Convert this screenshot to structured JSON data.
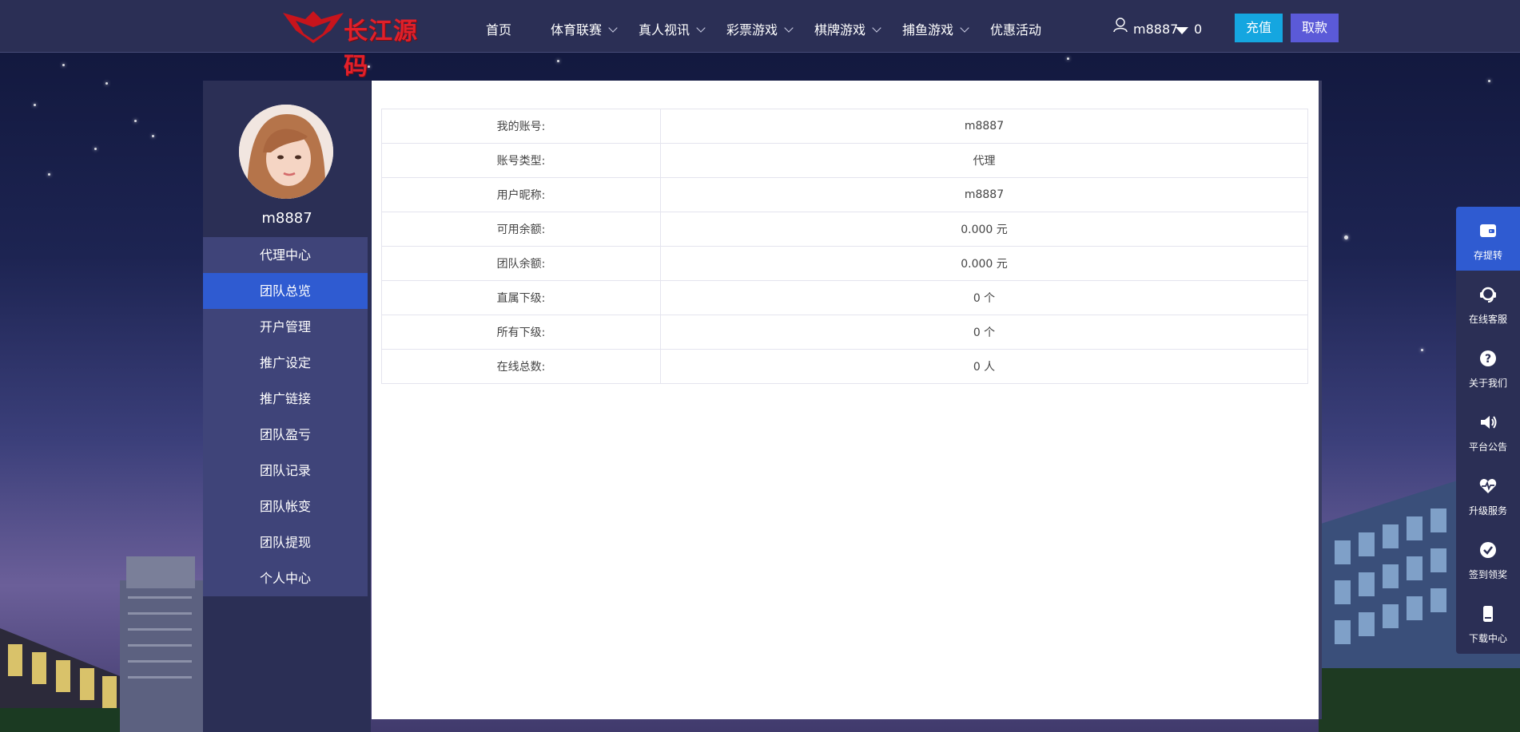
{
  "header": {
    "logo_text": "长江源码",
    "nav": [
      {
        "label": "首页",
        "dropdown": false
      },
      {
        "label": "体育联赛",
        "dropdown": true
      },
      {
        "label": "真人视讯",
        "dropdown": true
      },
      {
        "label": "彩票游戏",
        "dropdown": true
      },
      {
        "label": "棋牌游戏",
        "dropdown": true
      },
      {
        "label": "捕鱼游戏",
        "dropdown": true
      },
      {
        "label": "优惠活动",
        "dropdown": false
      }
    ],
    "user": {
      "name": "m8887",
      "balance": "0"
    },
    "deposit_label": "充值",
    "withdraw_label": "取款"
  },
  "sidebar": {
    "username": "m8887",
    "items": [
      {
        "label": "代理中心",
        "active": false
      },
      {
        "label": "团队总览",
        "active": true
      },
      {
        "label": "开户管理",
        "active": false
      },
      {
        "label": "推广设定",
        "active": false
      },
      {
        "label": "推广链接",
        "active": false
      },
      {
        "label": "团队盈亏",
        "active": false
      },
      {
        "label": "团队记录",
        "active": false
      },
      {
        "label": "团队帐变",
        "active": false
      },
      {
        "label": "团队提现",
        "active": false
      },
      {
        "label": "个人中心",
        "active": false
      }
    ]
  },
  "overview": {
    "rows": [
      {
        "label": "我的账号:",
        "value": "m8887"
      },
      {
        "label": "账号类型:",
        "value": "代理"
      },
      {
        "label": "用户昵称:",
        "value": "m8887"
      },
      {
        "label": "可用余额:",
        "value": "0.000 元"
      },
      {
        "label": "团队余额:",
        "value": "0.000 元"
      },
      {
        "label": "直属下级:",
        "value": "0 个"
      },
      {
        "label": "所有下级:",
        "value": "0 个"
      },
      {
        "label": "在线总数:",
        "value": "0 人"
      }
    ]
  },
  "float_bar": [
    {
      "label": "存提转",
      "icon": "wallet-icon",
      "active": true
    },
    {
      "label": "在线客服",
      "icon": "headset-icon",
      "active": false
    },
    {
      "label": "关于我们",
      "icon": "question-icon",
      "active": false
    },
    {
      "label": "平台公告",
      "icon": "speaker-icon",
      "active": false
    },
    {
      "label": "升级服务",
      "icon": "heart-pulse-icon",
      "active": false
    },
    {
      "label": "签到领奖",
      "icon": "check-circle-icon",
      "active": false
    },
    {
      "label": "下载中心",
      "icon": "mobile-icon",
      "active": false
    }
  ],
  "colors": {
    "accent": "#2f5bd1",
    "deposit": "#15a6e0",
    "withdraw": "#5b5ad8",
    "panel": "#2b2f55",
    "logo": "#e0202a"
  }
}
